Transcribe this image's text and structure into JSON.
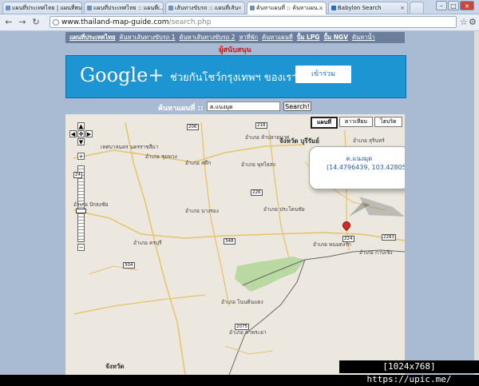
{
  "browser": {
    "tabs": [
      {
        "label": "แผนที่ประเทศไทย | แผนที่ถนน"
      },
      {
        "label": "แผนที่ประเทศไทย :: แผนที่..."
      },
      {
        "label": "เส้นทางขับรถ :: แผนที่เส้น"
      },
      {
        "label": "ค้นหาแผนที่ :: ค้นหาแผน...",
        "active": true
      },
      {
        "label": "Babylon Search"
      }
    ],
    "url_host": "www.thailand-map-guide.com",
    "url_path": "/search.php"
  },
  "page": {
    "menu": [
      "แผนที่ประเทศไทย",
      "ค้นหาเส้นทางขับรถ 1",
      "ค้นหาเส้นทางขับรถ 2",
      "หาที่พัก",
      "ค้นหาแผนที่",
      "ปั้ม LPG",
      "ปั้ม NGV",
      "ค้นหาน้ำ"
    ],
    "sponsor": "ผู้สนับสนุน",
    "ad": {
      "brand": "Google+",
      "text": "ช่วยกันโชว์กรุงเทพฯ ของเรา",
      "button": "เข้าร่วม"
    },
    "search": {
      "label": "ค้นหาแผนที่ ::",
      "value": "ต.แนงมุด",
      "button": "Search!"
    },
    "map": {
      "types": [
        "แผนที่",
        "ดาวเทียม",
        "ไฮบริด"
      ],
      "bubble_title": "ต.แนงมุด",
      "bubble_coords": "(14.4796439, 103.4280586)",
      "labels": [
        "เทศบาลนคร นครราชสีมา",
        "อำเภอ ชุมพวง",
        "อำเภอ ลำปลายมาศ",
        "จังหวัด บุรีรัมย์",
        "อำเภอ สตึก",
        "อำเภอ พุทไธสง",
        "อำเภอ สุรินทร์",
        "อำเภอ ปักธงชัย",
        "อำเภอ นางรอง",
        "อำเภอ ประโคนชัย",
        "อำเภอ ครบุรี",
        "อำเภอ โนนดินแดง",
        "อำเภอ พนมดงรัก",
        "อำเภอ กาบเชิง",
        "อำเภอ ตาพระยา",
        "จังหวัด"
      ],
      "routes": [
        "206",
        "24",
        "218",
        "226",
        "224",
        "2283",
        "348",
        "304",
        "2075"
      ]
    }
  },
  "watermark": "[1024x768] https://upic.me/"
}
